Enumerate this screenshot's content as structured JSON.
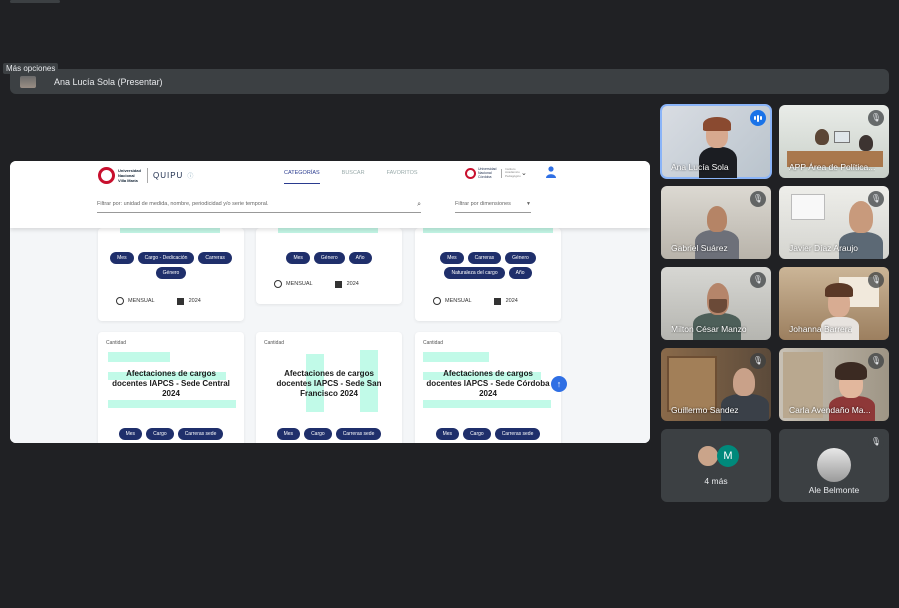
{
  "tooltip": "Más opciones",
  "presenter": {
    "label": "Ana Lucía Sola (Presentar)"
  },
  "shared_screen": {
    "logo_text": "Universidad Nacional Villa María",
    "app_name": "QUIPU",
    "tabs": [
      "CATEGORÍAS",
      "BUSCAR",
      "FAVORITOS"
    ],
    "active_tab": "CATEGORÍAS",
    "right_logo_text": "Universidad Nacional Córdoba",
    "right_logo_sub": "Instituto Académico Pedagógico",
    "filter_placeholder": "Filtrar por: unidad de medida, nombre, periodicidad y/o serie temporal.",
    "dimension_filter": "Filtrar por dimensiones",
    "top_cards": [
      {
        "chips": [
          "Mes",
          "Cargo - Dedicación",
          "Carreras",
          "Género"
        ],
        "period": "MENSUAL",
        "year": "2024"
      },
      {
        "chips": [
          "Mes",
          "Género",
          "Año"
        ],
        "period": "MENSUAL",
        "year": "2024"
      },
      {
        "chips": [
          "Mes",
          "Carreras",
          "Género",
          "Naturaleza del cargo",
          "Año"
        ],
        "period": "MENSUAL",
        "year": "2024"
      }
    ],
    "bottom_cards": [
      {
        "label": "Cantidad",
        "title": "Afectaciones de cargos docentes IAPCS - Sede Central 2024",
        "chips": [
          "Mes",
          "Cargo",
          "Carreras sede"
        ]
      },
      {
        "label": "Cantidad",
        "title": "Afectaciones de cargos docentes IAPCS - Sede San Francisco 2024",
        "chips": [
          "Mes",
          "Cargo",
          "Carreras sede"
        ]
      },
      {
        "label": "Cantidad",
        "title": "Afectaciones de cargos docentes IAPCS - Sede Córdoba 2024",
        "chips": [
          "Mes",
          "Cargo",
          "Carreras sede"
        ]
      }
    ],
    "fab_icon": "arrow-up-icon"
  },
  "participants": [
    {
      "name": "Ana Lucía Sola",
      "speaking": true
    },
    {
      "name": "APP Área de Política...",
      "muted": true
    },
    {
      "name": "Gabriel Suárez",
      "muted": true
    },
    {
      "name": "Javier Díaz Araujo",
      "muted": true
    },
    {
      "name": "Milton César Manzo",
      "muted": true
    },
    {
      "name": "Johanna Barrera",
      "muted": true
    },
    {
      "name": "Guillermo Sandez",
      "muted": true
    },
    {
      "name": "Carla Avendaño Ma...",
      "muted": true
    }
  ],
  "more": {
    "label": "4 más",
    "initial": "M"
  },
  "last_participant": {
    "name": "Ale Belmonte",
    "muted": true
  },
  "colors": {
    "background": "#202124",
    "tile": "#3c4043",
    "speaking": "#8ab4f8",
    "chip": "#1f2f6b",
    "accent_green": "#8ef5d5"
  }
}
